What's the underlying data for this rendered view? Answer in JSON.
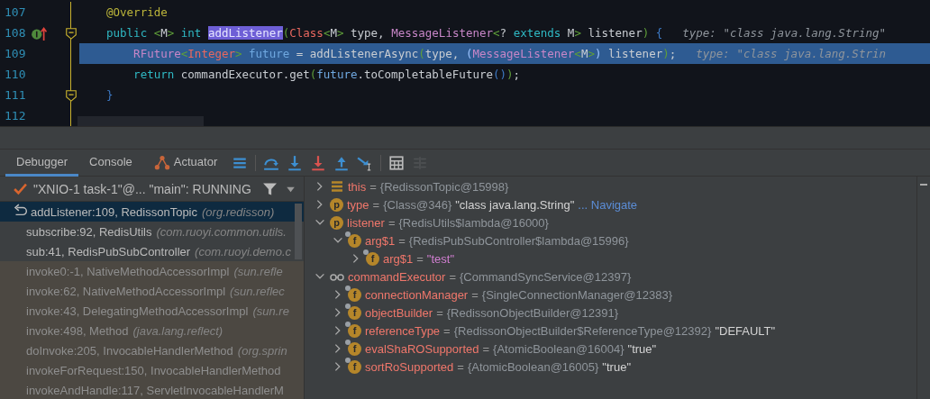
{
  "editor": {
    "lines": [
      {
        "number": "107",
        "current": false,
        "override": false,
        "fold": false,
        "tokens": [
          {
            "text": "@Override",
            "kind": "annotation"
          }
        ]
      },
      {
        "number": "108",
        "current": false,
        "override": true,
        "fold": true,
        "tokens": [
          {
            "text": "public ",
            "kind": "keyword"
          },
          {
            "text": "<",
            "kind": "angle"
          },
          {
            "text": "M",
            "kind": "plain"
          },
          {
            "text": "> ",
            "kind": "angle"
          },
          {
            "text": "int ",
            "kind": "keyword"
          },
          {
            "text": "addListener",
            "kind": "usage"
          },
          {
            "text": "(",
            "kind": "paren1"
          },
          {
            "text": "Class",
            "kind": "class"
          },
          {
            "text": "<",
            "kind": "angle"
          },
          {
            "text": "M",
            "kind": "plain"
          },
          {
            "text": ">",
            "kind": "angle"
          },
          {
            "text": " type, ",
            "kind": "plain"
          },
          {
            "text": "MessageListener",
            "kind": "iface"
          },
          {
            "text": "<",
            "kind": "angle"
          },
          {
            "text": "? ",
            "kind": "plain"
          },
          {
            "text": "extends",
            "kind": "keyword"
          },
          {
            "text": " M",
            "kind": "plain"
          },
          {
            "text": ">",
            "kind": "angle"
          },
          {
            "text": " listener",
            "kind": "plain"
          },
          {
            "text": ")",
            "kind": "paren1"
          },
          {
            "text": " {",
            "kind": "paren2"
          }
        ],
        "hint": "type: \"class java.lang.String\""
      },
      {
        "number": "109",
        "current": true,
        "override": false,
        "fold": false,
        "tokens": [
          {
            "text": "    RFuture",
            "kind": "iface"
          },
          {
            "text": "<",
            "kind": "angle"
          },
          {
            "text": "Integer",
            "kind": "class"
          },
          {
            "text": ">",
            "kind": "angle"
          },
          {
            "text": " future",
            "kind": "local"
          },
          {
            "text": " = addListenerAsync",
            "kind": "plain"
          },
          {
            "text": "(",
            "kind": "paren1"
          },
          {
            "text": "type, ",
            "kind": "plain"
          },
          {
            "text": "(",
            "kind": "paren2"
          },
          {
            "text": "MessageListener",
            "kind": "iface"
          },
          {
            "text": "<",
            "kind": "angle"
          },
          {
            "text": "M",
            "kind": "plain"
          },
          {
            "text": ">",
            "kind": "angle"
          },
          {
            "text": ")",
            "kind": "paren2"
          },
          {
            "text": " listener",
            "kind": "plain"
          },
          {
            "text": ")",
            "kind": "paren1"
          },
          {
            "text": ";",
            "kind": "plain"
          }
        ],
        "hint": "type: \"class java.lang.Strin"
      },
      {
        "number": "110",
        "current": false,
        "override": false,
        "fold": false,
        "tokens": [
          {
            "text": "    return",
            "kind": "keyword"
          },
          {
            "text": " commandExecutor.get",
            "kind": "plain"
          },
          {
            "text": "(",
            "kind": "paren1"
          },
          {
            "text": "future",
            "kind": "local"
          },
          {
            "text": ".toCompletableFuture",
            "kind": "plain"
          },
          {
            "text": "()",
            "kind": "paren2"
          },
          {
            "text": ")",
            "kind": "paren1"
          },
          {
            "text": ";",
            "kind": "plain"
          }
        ]
      },
      {
        "number": "111",
        "current": false,
        "override": false,
        "fold": true,
        "tokens": [
          {
            "text": "}",
            "kind": "paren2"
          }
        ]
      },
      {
        "number": "112",
        "current": false,
        "override": false,
        "fold": false
      }
    ]
  },
  "debug": {
    "tabs": [
      {
        "label": "Debugger",
        "selected": true,
        "icon": false
      },
      {
        "label": "Console",
        "selected": false,
        "icon": false
      },
      {
        "label": "Actuator",
        "selected": false,
        "icon": true
      }
    ],
    "toolbar": [
      {
        "kind": "menu",
        "disabled": false
      },
      {
        "kind": "step-over",
        "disabled": false
      },
      {
        "kind": "step-into",
        "disabled": false
      },
      {
        "kind": "force-step-into",
        "disabled": false
      },
      {
        "kind": "step-out",
        "disabled": false
      },
      {
        "kind": "run-to-cursor",
        "disabled": false
      },
      {
        "kind": "evaluate",
        "disabled": false
      },
      {
        "kind": "trace",
        "disabled": true
      }
    ],
    "thread": {
      "label": "\"XNIO-1 task-1\"@... \"main\": RUNNING"
    },
    "frames": [
      {
        "method": "addListener:109, RedissonTopic",
        "package": "(org.redisson)",
        "selected": true,
        "library": false
      },
      {
        "method": "subscribe:92, RedisUtils",
        "package": "(com.ruoyi.common.utils.",
        "selected": false,
        "library": false
      },
      {
        "method": "sub:41, RedisPubSubController",
        "package": "(com.ruoyi.demo.c",
        "selected": false,
        "library": false
      },
      {
        "method": "invoke0:-1, NativeMethodAccessorImpl",
        "package": "(sun.refle",
        "selected": false,
        "library": true
      },
      {
        "method": "invoke:62, NativeMethodAccessorImpl",
        "package": "(sun.reflec",
        "selected": false,
        "library": true
      },
      {
        "method": "invoke:43, DelegatingMethodAccessorImpl",
        "package": "(sun.re",
        "selected": false,
        "library": true
      },
      {
        "method": "invoke:498, Method",
        "package": "(java.lang.reflect)",
        "selected": false,
        "library": true
      },
      {
        "method": "doInvoke:205, InvocableHandlerMethod",
        "package": "(org.sprin",
        "selected": false,
        "library": true
      },
      {
        "method": "invokeForRequest:150, InvocableHandlerMethod",
        "selected": false,
        "library": true
      },
      {
        "method": "invokeAndHandle:117, ServletInvocableHandlerM",
        "selected": false,
        "library": true
      }
    ],
    "variables": [
      {
        "kind": "fields",
        "name": "this",
        "sign": "=",
        "expanded": false,
        "value": "{RedissonTopic@15998}"
      },
      {
        "kind": "param",
        "badge": "p",
        "name": "type",
        "sign": "=",
        "expanded": false,
        "value": "{Class@346}",
        "display": "\"class java.lang.String\"",
        "link": "... Navigate"
      },
      {
        "kind": "param",
        "badge": "p",
        "name": "listener",
        "sign": "=",
        "expanded": true,
        "value": "{RedisUtils$lambda@16000}",
        "children": [
          {
            "kind": "field",
            "badge": "f",
            "name": "arg$1",
            "sign": "=",
            "expanded": true,
            "value": "{RedisPubSubController$lambda@15996}",
            "children": [
              {
                "kind": "field",
                "badge": "f",
                "name": "arg$1",
                "sign": "=",
                "expanded": false,
                "literal": "\"test\""
              }
            ]
          }
        ]
      },
      {
        "kind": "watch",
        "name": "commandExecutor",
        "sign": "=",
        "expanded": true,
        "value": "{CommandSyncService@12397}",
        "children": [
          {
            "kind": "field",
            "badge": "f",
            "name": "connectionManager",
            "sign": "=",
            "expanded": false,
            "value": "{SingleConnectionManager@12383}"
          },
          {
            "kind": "field",
            "badge": "f",
            "name": "objectBuilder",
            "sign": "=",
            "expanded": false,
            "value": "{RedissonObjectBuilder@12391}"
          },
          {
            "kind": "field",
            "badge": "f",
            "name": "referenceType",
            "sign": "=",
            "expanded": false,
            "value": "{RedissonObjectBuilder$ReferenceType@12392}",
            "display": "\"DEFAULT\""
          },
          {
            "kind": "field",
            "badge": "f",
            "name": "evalShaROSupported",
            "sign": "=",
            "expanded": false,
            "value": "{AtomicBoolean@16004}",
            "display": "\"true\""
          },
          {
            "kind": "field",
            "badge": "f",
            "name": "sortRoSupported",
            "sign": "=",
            "expanded": false,
            "value": "{AtomicBoolean@16005}",
            "display": "\"true\""
          }
        ]
      }
    ]
  }
}
